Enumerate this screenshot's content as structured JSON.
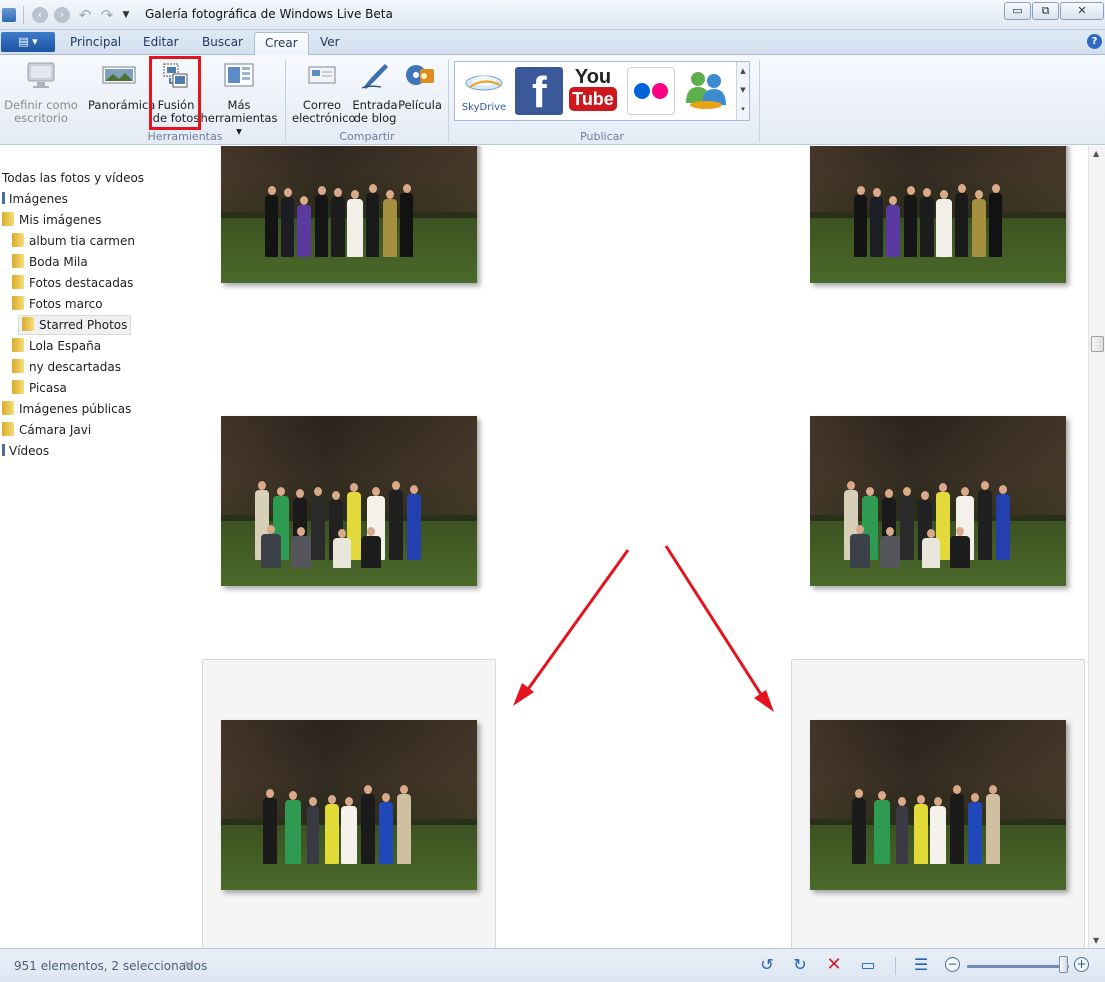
{
  "window": {
    "title": "Galería fotográfica de Windows Live Beta",
    "min_glyph": "▭",
    "max_glyph": "⧉",
    "close_glyph": "✕"
  },
  "ribbon_tabs": [
    "Principal",
    "Editar",
    "Buscar",
    "Crear",
    "Ver"
  ],
  "active_tab": "Crear",
  "ribbon": {
    "groups": {
      "herramientas": {
        "label": "Herramientas",
        "buttons": [
          {
            "line1": "Definir como",
            "line2": "escritorio",
            "enabled": false,
            "icon": "monitor-icon"
          },
          {
            "line1": "Panorámica",
            "line2": "",
            "enabled": true,
            "icon": "panorama-icon"
          },
          {
            "line1": "Fusión",
            "line2": "de fotos",
            "enabled": true,
            "icon": "photo-fuse-icon"
          },
          {
            "line1": "Más",
            "line2": "herramientas ▾",
            "enabled": true,
            "icon": "more-tools-icon"
          }
        ]
      },
      "compartir": {
        "label": "Compartir",
        "buttons": [
          {
            "line1": "Correo",
            "line2": "electrónico",
            "icon": "email-icon"
          },
          {
            "line1": "Entrada",
            "line2": "de blog",
            "icon": "blog-pen-icon"
          },
          {
            "line1": "Película",
            "line2": "",
            "icon": "movie-icon"
          }
        ]
      },
      "publicar": {
        "label": "Publicar",
        "gallery": [
          {
            "name": "SkyDrive",
            "icon": "skydrive-icon"
          },
          {
            "name": "f",
            "icon": "facebook-icon",
            "color": "#3b5998"
          },
          {
            "name": "You",
            "name2": "Tube",
            "icon": "youtube-icon",
            "color": "#cc181e"
          },
          {
            "name": "flickr",
            "icon": "flickr-icon",
            "dot1": "#0063dc",
            "dot2": "#ff0084"
          },
          {
            "name": "Messenger",
            "icon": "messenger-icon"
          }
        ]
      }
    }
  },
  "nav": {
    "items": [
      {
        "label": "Todas las fotos y vídeos",
        "type": "root"
      },
      {
        "label": "Imágenes",
        "type": "library"
      },
      {
        "label": "Mis imágenes",
        "type": "folder"
      },
      {
        "label": "album tia carmen",
        "type": "folder"
      },
      {
        "label": "Boda Mila",
        "type": "folder"
      },
      {
        "label": "Fotos destacadas",
        "type": "folder"
      },
      {
        "label": "Fotos marco",
        "type": "folder"
      },
      {
        "label": "Starred Photos",
        "type": "folder",
        "selected": true
      },
      {
        "label": "Lola España",
        "type": "folder"
      },
      {
        "label": "ny descartadas",
        "type": "folder"
      },
      {
        "label": "Picasa",
        "type": "folder"
      },
      {
        "label": "Imágenes públicas",
        "type": "folder"
      },
      {
        "label": "Cámara Javi",
        "type": "folder"
      },
      {
        "label": "Vídeos",
        "type": "library"
      }
    ]
  },
  "status": {
    "text": "951 elementos, 2 seleccionados",
    "zoom_level": 0.9
  },
  "annotation": {
    "highlight_color": "#e3141d",
    "arrow_color": "#e3141d"
  }
}
